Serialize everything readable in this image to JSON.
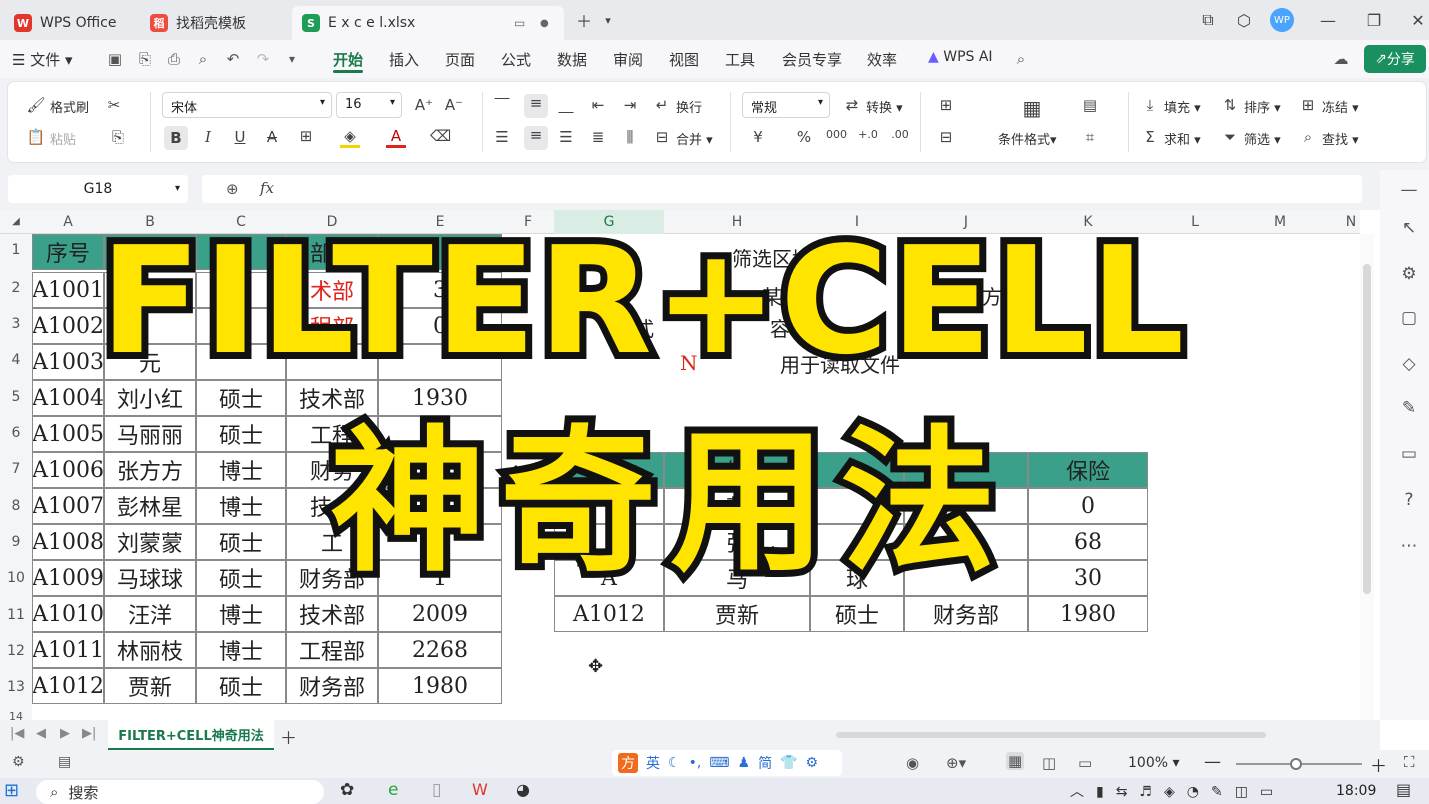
{
  "tabs": [
    {
      "label": "WPS Office"
    },
    {
      "label": "找稻壳模板"
    },
    {
      "label": "E x c e l.xlsx"
    }
  ],
  "menu": {
    "file": "文件",
    "items": [
      "开始",
      "插入",
      "页面",
      "公式",
      "数据",
      "审阅",
      "视图",
      "工具",
      "会员专享",
      "效率"
    ],
    "wps_ai": "WPS AI",
    "share": "分享"
  },
  "ribbon": {
    "format_painter": "格式刷",
    "paste": "粘贴",
    "font_name": "宋体",
    "font_size": "16",
    "wrap": "换行",
    "merge": "合并",
    "number_format": "常规",
    "convert": "转换",
    "cond_format": "条件格式",
    "fill": "填充",
    "sort": "排序",
    "freeze": "冻结",
    "sum": "求和",
    "filter": "筛选",
    "find": "查找"
  },
  "formula_bar": {
    "name_box": "G18",
    "fx": "fx"
  },
  "columns": [
    "A",
    "B",
    "C",
    "D",
    "E",
    "F",
    "G",
    "H",
    "I",
    "J",
    "K",
    "L",
    "M",
    "N"
  ],
  "rows": [
    "1",
    "2",
    "3",
    "4",
    "5",
    "6",
    "7",
    "8",
    "9",
    "10",
    "11",
    "12",
    "13",
    "14"
  ],
  "left_table": {
    "header": [
      "序号",
      "",
      "",
      "部门",
      ""
    ],
    "rows": [
      [
        "A1001",
        "",
        "",
        "术部",
        "3"
      ],
      [
        "A1002",
        "",
        "",
        "程部",
        "0"
      ],
      [
        "A1003",
        "元",
        "",
        "",
        ""
      ],
      [
        "A1004",
        "刘小红",
        "硕士",
        "技术部",
        "1930"
      ],
      [
        "A1005",
        "马丽丽",
        "硕士",
        "工程",
        "2"
      ],
      [
        "A1006",
        "张方方",
        "博士",
        "财务",
        ""
      ],
      [
        "A1007",
        "彭林星",
        "博士",
        "技术",
        ""
      ],
      [
        "A1008",
        "刘蒙蒙",
        "硕士",
        "工",
        ""
      ],
      [
        "A1009",
        "马球球",
        "硕士",
        "财务部",
        "1"
      ],
      [
        "A1010",
        "汪洋",
        "博士",
        "技术部",
        "2009"
      ],
      [
        "A1011",
        "林丽枝",
        "博士",
        "工程部",
        "2268"
      ],
      [
        "A1012",
        "贾新",
        "硕士",
        "财务部",
        "1980"
      ]
    ]
  },
  "notes": {
    "line1": "筛选区域或数组",
    "line2a": "CE",
    "line2b": "某",
    "line2c": "上",
    "line2d": "方",
    "line3a": "格式",
    "line3b": "容",
    "line4a": "N",
    "line4b": "用于读取文件"
  },
  "right_table": {
    "header": [
      "",
      "姓",
      "",
      "",
      "保险"
    ],
    "rows": [
      [
        "",
        "彭",
        "",
        "",
        "0"
      ],
      [
        "",
        "张",
        "",
        "",
        "68"
      ],
      [
        "A",
        "马",
        "球",
        "",
        "30"
      ],
      [
        "A1012",
        "贾新",
        "硕士",
        "财务部",
        "1980"
      ]
    ]
  },
  "overlay": {
    "line1": "FILTER+CELL",
    "line2": "神奇用法"
  },
  "sheet_tab": "FILTER+CELL神奇用法",
  "status": {
    "zoom": "100%",
    "ime": "英",
    "simplified": "简"
  },
  "taskbar": {
    "search": "搜索",
    "time": "18:09"
  }
}
